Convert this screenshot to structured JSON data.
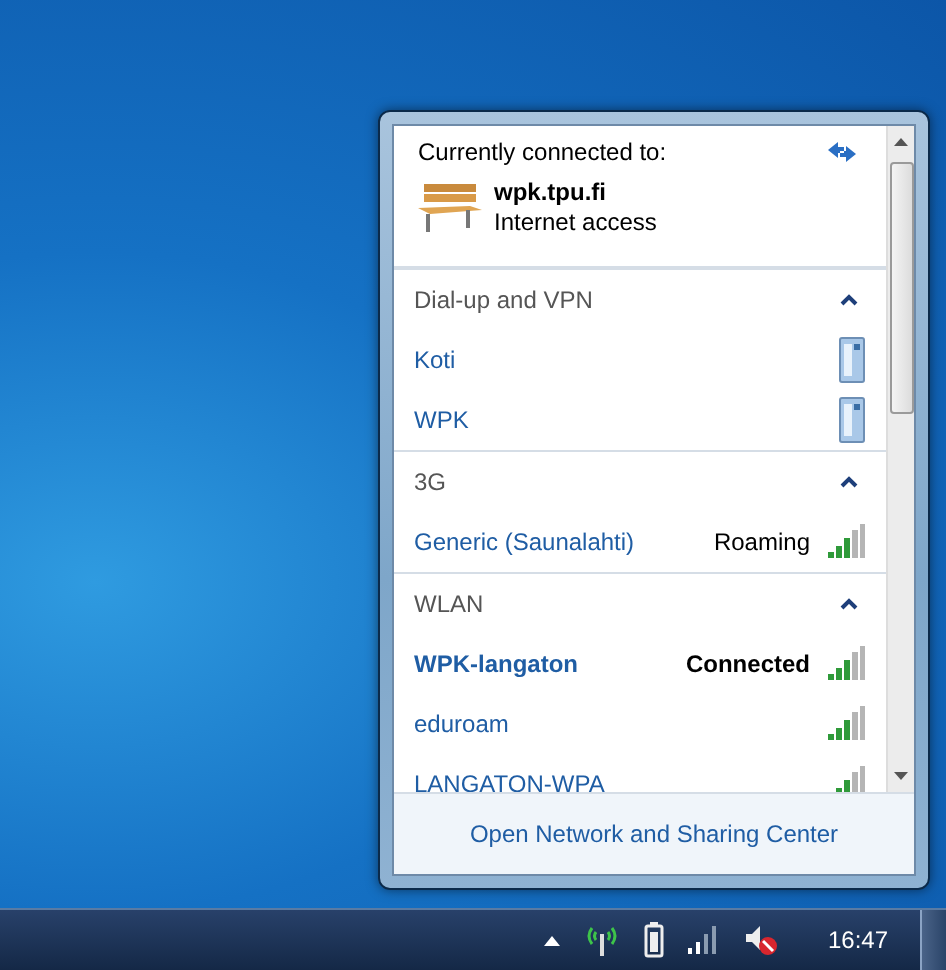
{
  "header": {
    "title": "Currently connected to:",
    "network": "wpk.tpu.fi",
    "access": "Internet access"
  },
  "groups": [
    {
      "title": "Dial-up and VPN",
      "expanded": true,
      "items": [
        {
          "name": "Koti",
          "kind": "vpn",
          "connected": false
        },
        {
          "name": "WPK",
          "kind": "vpn",
          "connected": false
        }
      ]
    },
    {
      "title": "3G",
      "expanded": true,
      "items": [
        {
          "name": "Generic (Saunalahti)",
          "kind": "signal",
          "status": "Roaming",
          "connected": false
        }
      ]
    },
    {
      "title": "WLAN",
      "expanded": true,
      "items": [
        {
          "name": "WPK-langaton",
          "kind": "signal",
          "status": "Connected",
          "connected": true
        },
        {
          "name": "eduroam",
          "kind": "signal",
          "connected": false
        },
        {
          "name": "LANGATON-WPA",
          "kind": "signal",
          "connected": false
        }
      ]
    }
  ],
  "footer_link": "Open Network and Sharing Center",
  "taskbar": {
    "clock": "16:47"
  }
}
